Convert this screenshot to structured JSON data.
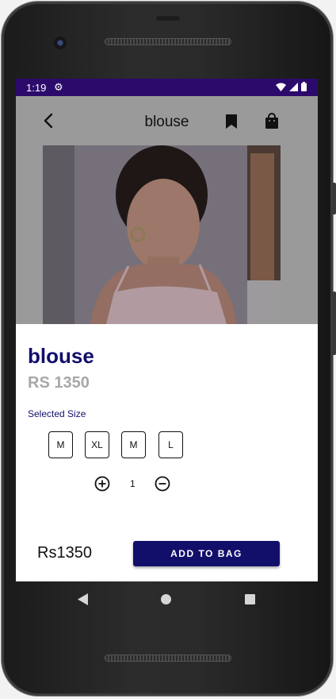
{
  "status_bar": {
    "time": "1:19"
  },
  "app_bar": {
    "title": "blouse"
  },
  "product": {
    "name": "blouse",
    "price": "RS 1350"
  },
  "size_section": {
    "label": "Selected Size",
    "sizes": [
      "M",
      "XL",
      "M",
      "L"
    ]
  },
  "quantity": {
    "value": "1"
  },
  "footer": {
    "total": "Rs1350",
    "add_button": "ADD TO BAG"
  },
  "colors": {
    "status_bar": "#2c0a6b",
    "primary": "#120f6b",
    "price_gray": "#a8a8a8"
  }
}
